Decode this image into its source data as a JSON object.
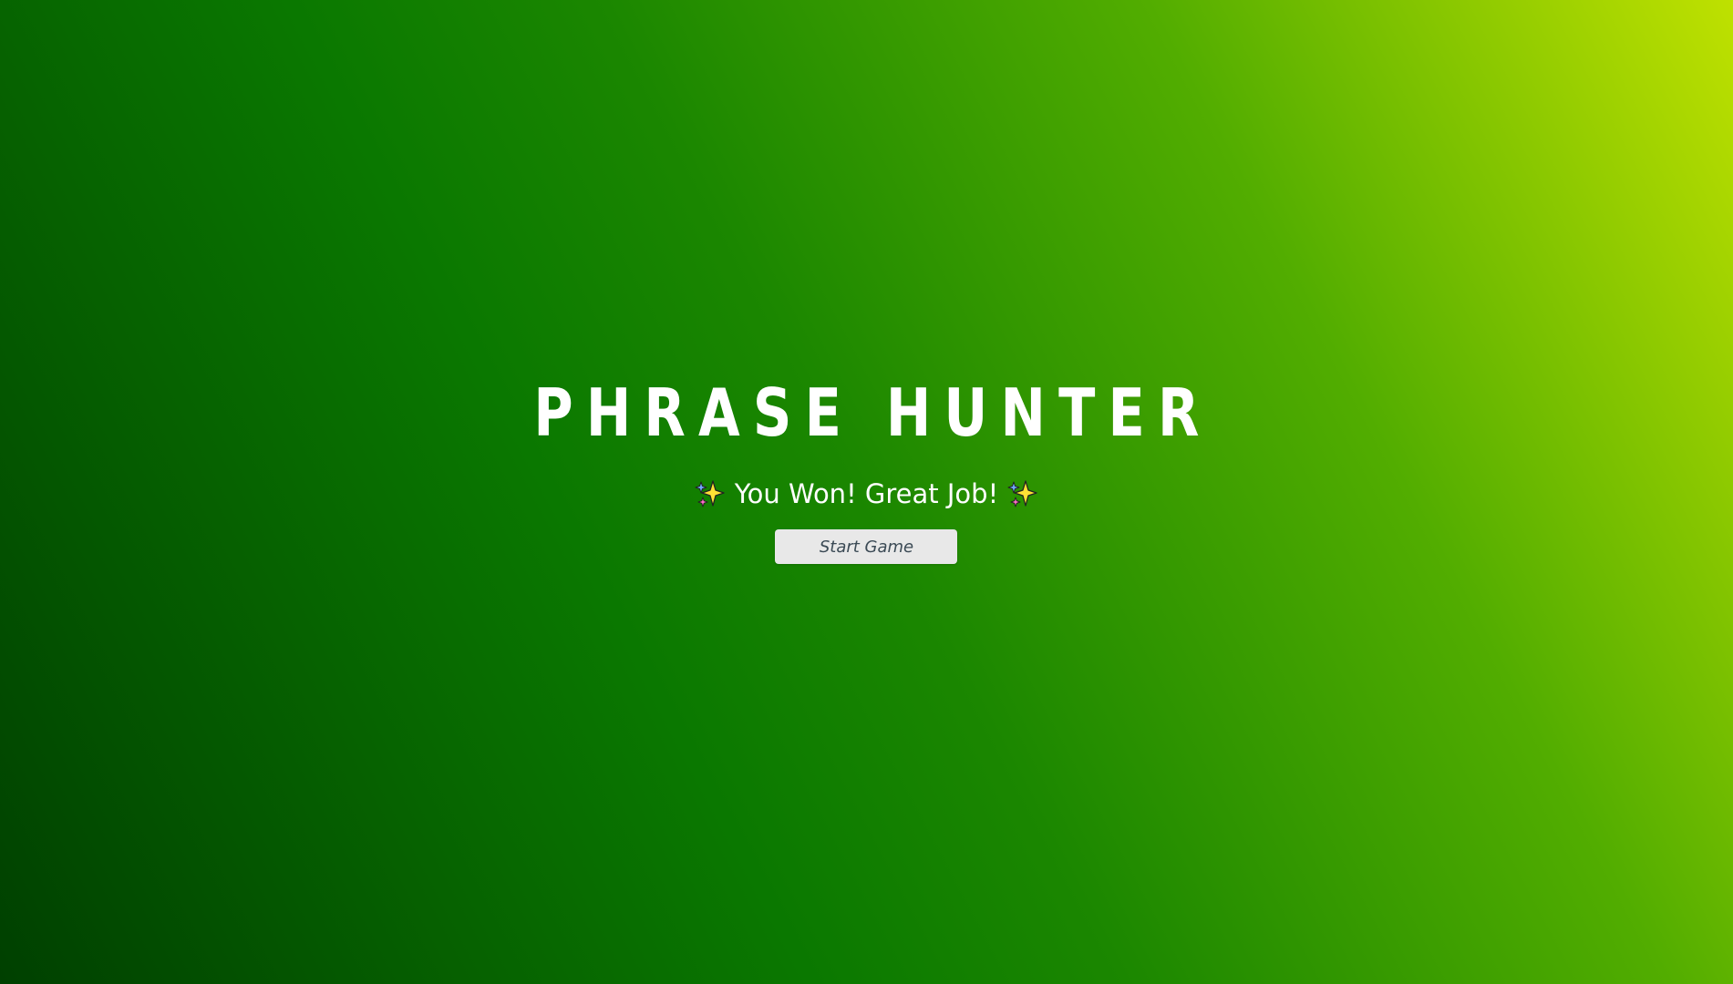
{
  "title": "PHRASE HUNTER",
  "message": {
    "text": "You Won! Great Job!",
    "icon": "sparkles-icon"
  },
  "start_button": {
    "label": "Start Game"
  },
  "colors": {
    "gradient_dark": "#004000",
    "gradient_mid": "#1b8700",
    "gradient_light": "#bfe100",
    "title_text": "#ffffff",
    "button_bg": "#e8e8e8",
    "button_text": "#3b4a55"
  }
}
